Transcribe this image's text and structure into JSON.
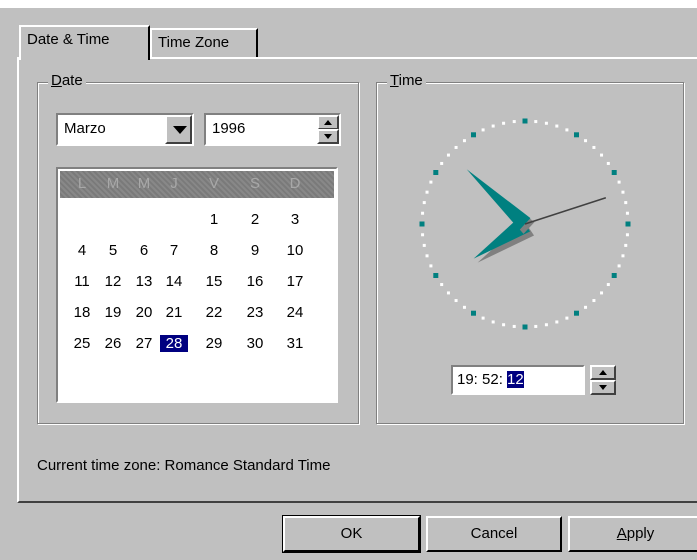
{
  "tabs": [
    {
      "label": "Date & Time",
      "active": true
    },
    {
      "label": "Time Zone",
      "active": false
    }
  ],
  "date_group": {
    "label_prefix": "D",
    "label_rest": "ate",
    "month": "Marzo",
    "year": "1996"
  },
  "calendar": {
    "day_names": [
      "L",
      "M",
      "M",
      "J",
      "V",
      "S",
      "D"
    ],
    "weeks": [
      [
        "",
        "",
        "",
        "",
        "1",
        "2",
        "3"
      ],
      [
        "4",
        "5",
        "6",
        "7",
        "8",
        "9",
        "10"
      ],
      [
        "11",
        "12",
        "13",
        "14",
        "15",
        "16",
        "17"
      ],
      [
        "18",
        "19",
        "20",
        "21",
        "22",
        "23",
        "24"
      ],
      [
        "25",
        "26",
        "27",
        "28",
        "29",
        "30",
        "31"
      ]
    ],
    "selected_day": "28"
  },
  "time_group": {
    "label_prefix": "T",
    "label_rest": "ime",
    "time_prefix": "19: 52: ",
    "time_selected": "12",
    "clock": {
      "hours": 19,
      "minutes": 52,
      "seconds": 12
    }
  },
  "timezone_text": "Current time zone:  Romance Standard Time",
  "buttons": {
    "ok": "OK",
    "cancel": "Cancel",
    "apply_prefix": "A",
    "apply_rest": "pply"
  },
  "colors": {
    "face": "#c0c0c0",
    "selection": "#000080",
    "clock_hand": "#008080"
  }
}
